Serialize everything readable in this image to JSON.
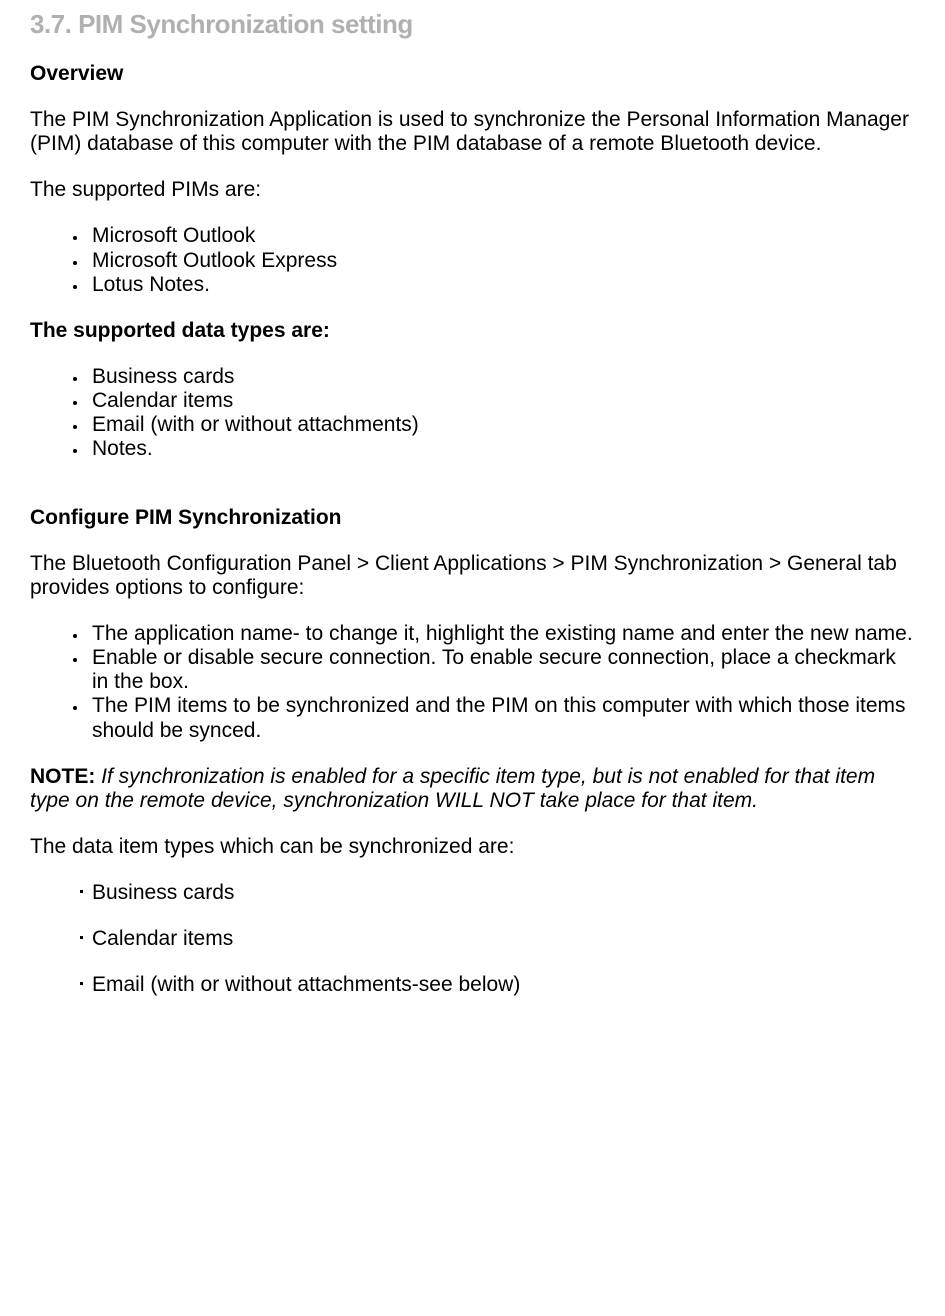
{
  "title": "3.7. PIM Synchronization setting",
  "overview_heading": "Overview",
  "overview_p1": "The PIM Synchronization Application is used to synchronize the Personal Information Manager (PIM) database of this computer with the PIM database of a remote Bluetooth device.",
  "overview_p2": "The supported PIMs are:",
  "pims": [
    "Microsoft Outlook",
    "Microsoft Outlook Express",
    "Lotus Notes."
  ],
  "data_types_heading": "The supported data types are:",
  "data_types": [
    "Business cards",
    "Calendar items",
    "Email (with or without attachments)",
    "Notes."
  ],
  "configure_heading": "Configure PIM Synchronization",
  "configure_p1": "The Bluetooth Configuration Panel > Client Applications > PIM Synchronization > General tab provides options to configure:",
  "configure_items": [
    "The application name- to change it, highlight the existing name and enter the new name.",
    "Enable or disable secure connection. To enable secure connection, place a checkmark in the box.",
    "The PIM items to be synchronized and the PIM on this computer with which those items should be synced."
  ],
  "note_label": "NOTE:",
  "note_text": "If synchronization is enabled for a specific item type, but is not enabled for that item type on the remote device, synchronization WILL NOT take place for that item.",
  "sync_types_intro": "The data item types which can be synchronized are:",
  "sync_types": [
    "Business cards",
    "Calendar items",
    "Email (with or without attachments-see below)"
  ]
}
